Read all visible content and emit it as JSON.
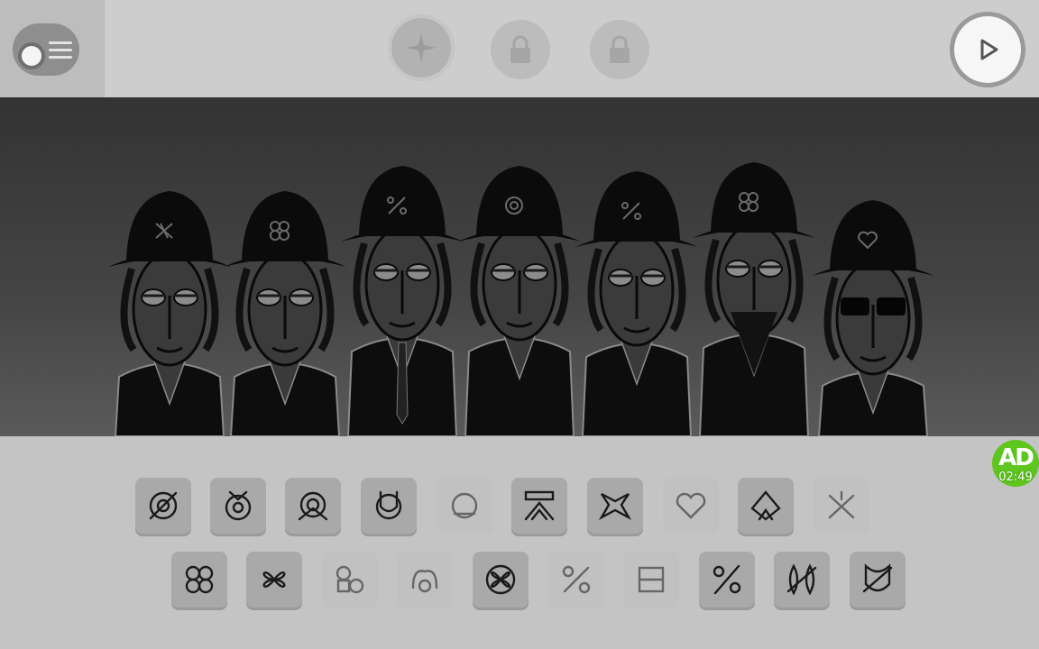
{
  "top_bar": {
    "menu_icon": "menu-toggle-icon",
    "bonus_icon": "sparkle-icon",
    "locks": [
      "padlock-icon",
      "padlock-icon"
    ],
    "play_icon": "play-icon"
  },
  "stage": {
    "characters": [
      {
        "hat_symbol": "XX",
        "outfit": "necklace"
      },
      {
        "hat_symbol": "clover",
        "outfit": "v-neck"
      },
      {
        "hat_symbol": "%",
        "outfit": "suit-tie"
      },
      {
        "hat_symbol": "@",
        "outfit": "pendant"
      },
      {
        "hat_symbol": "%",
        "outfit": "bowtie"
      },
      {
        "hat_symbol": "clover",
        "outfit": "beard"
      },
      {
        "hat_symbol": "heart",
        "outfit": "sunglasses-vest"
      }
    ]
  },
  "palette": {
    "row_top": [
      {
        "icon": "beat-icon-1",
        "enabled": true
      },
      {
        "icon": "beat-icon-2",
        "enabled": true
      },
      {
        "icon": "beat-icon-3",
        "enabled": true
      },
      {
        "icon": "beat-icon-4",
        "enabled": true
      },
      {
        "icon": "beat-icon-5",
        "enabled": false
      },
      {
        "icon": "effect-icon-1",
        "enabled": true
      },
      {
        "icon": "effect-icon-2",
        "enabled": true
      },
      {
        "icon": "effect-icon-3",
        "enabled": false
      },
      {
        "icon": "effect-icon-4",
        "enabled": true
      },
      {
        "icon": "effect-icon-5",
        "enabled": false
      }
    ],
    "row_bottom": [
      {
        "icon": "melody-icon-1",
        "enabled": true
      },
      {
        "icon": "melody-icon-2",
        "enabled": true
      },
      {
        "icon": "melody-icon-3",
        "enabled": false
      },
      {
        "icon": "melody-icon-4",
        "enabled": false
      },
      {
        "icon": "melody-icon-5",
        "enabled": true
      },
      {
        "icon": "voice-icon-1",
        "enabled": false
      },
      {
        "icon": "voice-icon-2",
        "enabled": false
      },
      {
        "icon": "voice-icon-3",
        "enabled": true
      },
      {
        "icon": "voice-icon-4",
        "enabled": true
      },
      {
        "icon": "voice-icon-5",
        "enabled": true
      }
    ]
  },
  "ad_badge": {
    "label": "AD",
    "timer": "02:49",
    "color": "#5fc51f"
  },
  "colors": {
    "stage_dark": "#333333",
    "panel_gray": "#c4c4c4"
  }
}
